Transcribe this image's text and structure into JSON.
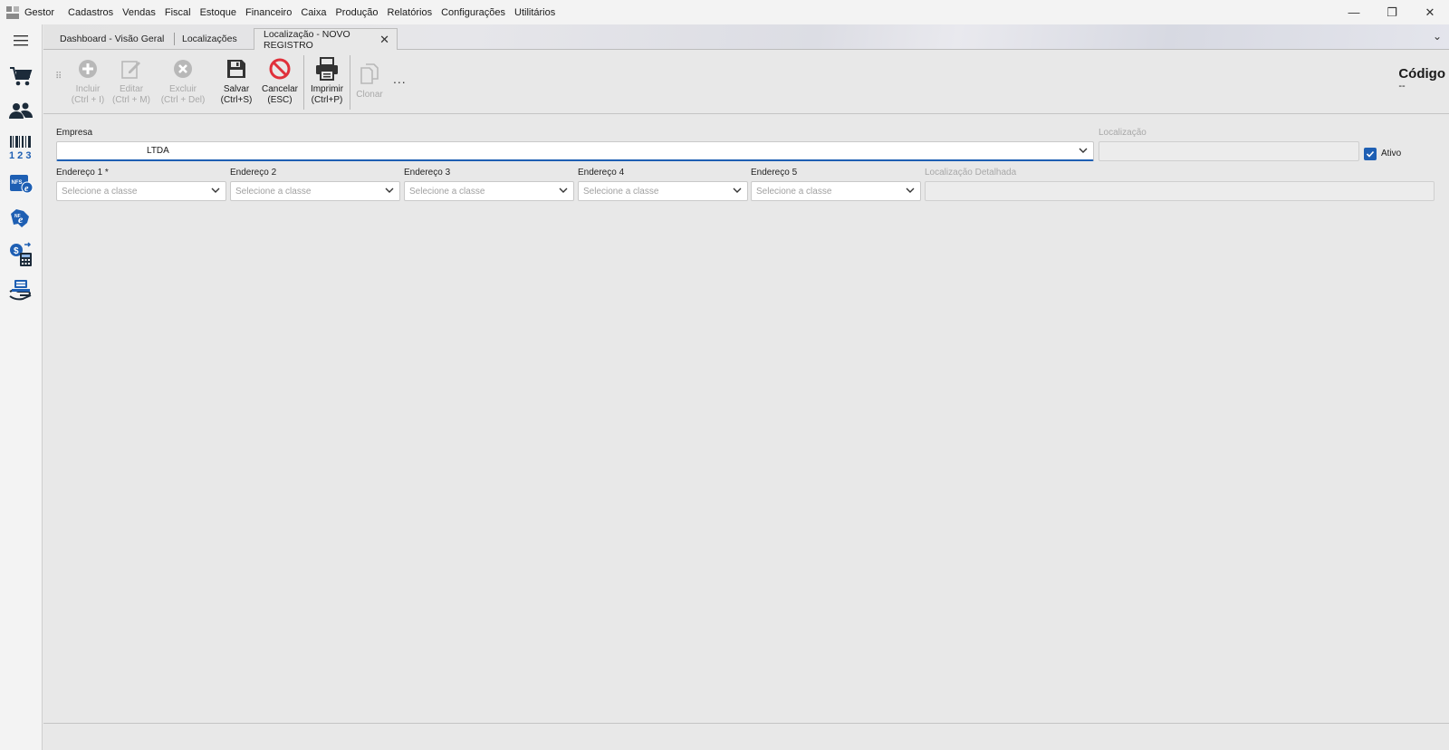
{
  "app": {
    "name": "Gestor"
  },
  "menu": [
    "Cadastros",
    "Vendas",
    "Fiscal",
    "Estoque",
    "Financeiro",
    "Caixa",
    "Produção",
    "Relatórios",
    "Configurações",
    "Utilitários"
  ],
  "window": {
    "minimize": "—",
    "restore": "❐",
    "close": "✕"
  },
  "tabs": [
    {
      "label": "Dashboard - Visão Geral"
    },
    {
      "label": "Localizações"
    },
    {
      "label": "Localização - NOVO REGISTRO"
    }
  ],
  "tab_close": "✕",
  "tab_menu": "⌄",
  "toolbar": {
    "incluir": {
      "label": "Incluir",
      "shortcut": "(Ctrl + I)"
    },
    "editar": {
      "label": "Editar",
      "shortcut": "(Ctrl + M)"
    },
    "excluir": {
      "label": "Excluir",
      "shortcut": "(Ctrl + Del)"
    },
    "salvar": {
      "label": "Salvar",
      "shortcut": "(Ctrl+S)"
    },
    "cancelar": {
      "label": "Cancelar",
      "shortcut": "(ESC)"
    },
    "imprimir": {
      "label": "Imprimir",
      "shortcut": "(Ctrl+P)"
    },
    "clonar": {
      "label": "Clonar"
    },
    "more": "..."
  },
  "codigo": {
    "label": "Código",
    "value": "--"
  },
  "form": {
    "empresa": {
      "label": "Empresa",
      "value": "LTDA"
    },
    "localizacao": {
      "label": "Localização",
      "value": ""
    },
    "ativo": {
      "label": "Ativo",
      "checked": true
    },
    "endereco1": {
      "label": "Endereço 1 *",
      "placeholder": "Selecione a classe"
    },
    "endereco2": {
      "label": "Endereço 2",
      "placeholder": "Selecione a classe"
    },
    "endereco3": {
      "label": "Endereço 3",
      "placeholder": "Selecione a classe"
    },
    "endereco4": {
      "label": "Endereço 4",
      "placeholder": "Selecione a classe"
    },
    "endereco5": {
      "label": "Endereço 5",
      "placeholder": "Selecione a classe"
    },
    "localizacao_detalhada": {
      "label": "Localização Detalhada",
      "value": ""
    }
  },
  "colors": {
    "accent": "#1e5fb3",
    "danger": "#e0303a",
    "disabled": "#a9a9a9"
  }
}
